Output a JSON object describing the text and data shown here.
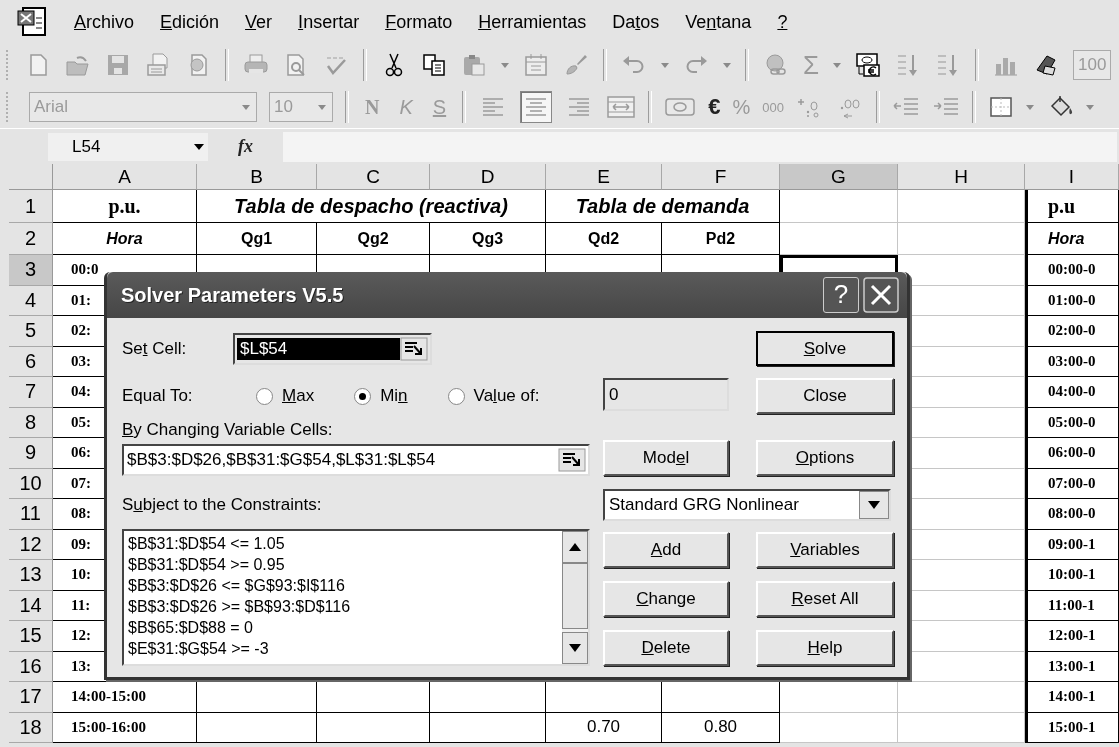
{
  "menu_bar": {
    "items": [
      {
        "key": "A",
        "post": "rchivo"
      },
      {
        "key": "E",
        "post": "dición"
      },
      {
        "key": "V",
        "post": "er"
      },
      {
        "key": "I",
        "post": "nsertar"
      },
      {
        "key": "F",
        "post": "ormato"
      },
      {
        "key": "H",
        "post": "erramientas"
      },
      {
        "pre": "Da",
        "key": "t",
        "post": "os"
      },
      {
        "pre": "Ve",
        "key": "n",
        "post": "tana"
      },
      {
        "key": "?"
      }
    ]
  },
  "standard_toolbar": {
    "autosum": "Σ",
    "zoom": "100"
  },
  "formatting_toolbar": {
    "font": "Arial",
    "size": "10",
    "style_buttons": [
      "N",
      "K",
      "S"
    ],
    "alignment": [
      {
        "selected": false
      },
      {
        "selected": true
      },
      {
        "selected": false
      }
    ],
    "number_buttons": [
      "€",
      "%",
      "000"
    ]
  },
  "formula_bar": {
    "name_box": "L54",
    "function_label": "fx"
  },
  "sheet": {
    "columns": [
      {
        "label": "A",
        "selected": false,
        "boxed": true
      },
      {
        "label": "B",
        "selected": false,
        "boxed": true
      },
      {
        "label": "C",
        "selected": false,
        "boxed": true
      },
      {
        "label": "D",
        "selected": false,
        "boxed": true
      },
      {
        "label": "E",
        "selected": false,
        "boxed": true
      },
      {
        "label": "F",
        "selected": false,
        "boxed": true
      },
      {
        "label": "G",
        "selected": true,
        "boxed": false
      },
      {
        "label": "H",
        "selected": false,
        "boxed": false
      },
      {
        "label": "I",
        "selected": false,
        "boxed": true
      }
    ],
    "rows": [
      {
        "label": "1",
        "selected": false,
        "cells": [
          {
            "text": "p.u.",
            "kind": "unit"
          },
          {
            "text": "Tabla de despacho (reactiva)",
            "kind": "title"
          },
          {
            "merged": true
          },
          {
            "merged": true
          },
          {
            "text": "Tabla de demanda",
            "kind": "title"
          },
          {
            "merged": true
          },
          null,
          null,
          {
            "text": "p.u",
            "kind": "unit"
          }
        ]
      },
      {
        "label": "2",
        "selected": false,
        "cells": [
          {
            "text": "Hora",
            "kind": "heading_italic"
          },
          {
            "text": "Qg1",
            "kind": "heading"
          },
          {
            "text": "Qg2",
            "kind": "heading"
          },
          {
            "text": "Qg3",
            "kind": "heading"
          },
          {
            "text": "Qd2",
            "kind": "heading"
          },
          {
            "text": "Pd2",
            "kind": "heading"
          },
          null,
          null,
          {
            "text": "Hora",
            "kind": "heading_italic"
          }
        ]
      },
      {
        "label": "3",
        "selected": true,
        "cells": [
          {
            "text": "00:0",
            "kind": "time"
          },
          null,
          null,
          null,
          null,
          null,
          {
            "outlined": true
          },
          null,
          {
            "text": "00:00-0",
            "kind": "time"
          }
        ]
      },
      {
        "label": "4",
        "selected": false,
        "cells": [
          {
            "text": "01:",
            "kind": "time"
          },
          null,
          null,
          null,
          null,
          null,
          null,
          null,
          {
            "text": "01:00-0",
            "kind": "time"
          }
        ]
      },
      {
        "label": "5",
        "selected": false,
        "cells": [
          {
            "text": "02:",
            "kind": "time"
          },
          null,
          null,
          null,
          null,
          null,
          null,
          null,
          {
            "text": "02:00-0",
            "kind": "time"
          }
        ]
      },
      {
        "label": "6",
        "selected": false,
        "cells": [
          {
            "text": "03:",
            "kind": "time"
          },
          null,
          null,
          null,
          null,
          null,
          null,
          null,
          {
            "text": "03:00-0",
            "kind": "time"
          }
        ]
      },
      {
        "label": "7",
        "selected": false,
        "cells": [
          {
            "text": "04:",
            "kind": "time"
          },
          null,
          null,
          null,
          null,
          null,
          null,
          null,
          {
            "text": "04:00-0",
            "kind": "time"
          }
        ]
      },
      {
        "label": "8",
        "selected": false,
        "cells": [
          {
            "text": "05:",
            "kind": "time"
          },
          null,
          null,
          null,
          null,
          null,
          null,
          null,
          {
            "text": "05:00-0",
            "kind": "time"
          }
        ]
      },
      {
        "label": "9",
        "selected": false,
        "cells": [
          {
            "text": "06:",
            "kind": "time"
          },
          null,
          null,
          null,
          null,
          null,
          null,
          null,
          {
            "text": "06:00-0",
            "kind": "time"
          }
        ]
      },
      {
        "label": "10",
        "selected": false,
        "cells": [
          {
            "text": "07:",
            "kind": "time"
          },
          null,
          null,
          null,
          null,
          null,
          null,
          null,
          {
            "text": "07:00-0",
            "kind": "time"
          }
        ]
      },
      {
        "label": "11",
        "selected": false,
        "cells": [
          {
            "text": "08:",
            "kind": "time"
          },
          null,
          null,
          null,
          null,
          null,
          null,
          null,
          {
            "text": "08:00-0",
            "kind": "time"
          }
        ]
      },
      {
        "label": "12",
        "selected": false,
        "cells": [
          {
            "text": "09:",
            "kind": "time"
          },
          null,
          null,
          null,
          null,
          null,
          null,
          null,
          {
            "text": "09:00-1",
            "kind": "time"
          }
        ]
      },
      {
        "label": "13",
        "selected": false,
        "cells": [
          {
            "text": "10:",
            "kind": "time"
          },
          null,
          null,
          null,
          null,
          null,
          null,
          null,
          {
            "text": "10:00-1",
            "kind": "time"
          }
        ]
      },
      {
        "label": "14",
        "selected": false,
        "cells": [
          {
            "text": "11:",
            "kind": "time"
          },
          null,
          null,
          null,
          null,
          null,
          null,
          null,
          {
            "text": "11:00-1",
            "kind": "time"
          }
        ]
      },
      {
        "label": "15",
        "selected": false,
        "cells": [
          {
            "text": "12:",
            "kind": "time"
          },
          null,
          null,
          null,
          null,
          null,
          null,
          null,
          {
            "text": "12:00-1",
            "kind": "time"
          }
        ]
      },
      {
        "label": "16",
        "selected": false,
        "cells": [
          {
            "text": "13:",
            "kind": "time"
          },
          null,
          null,
          null,
          null,
          null,
          null,
          null,
          {
            "text": "13:00-1",
            "kind": "time"
          }
        ]
      },
      {
        "label": "17",
        "selected": false,
        "cells": [
          {
            "text": "14:00-15:00",
            "kind": "time"
          },
          null,
          null,
          null,
          null,
          null,
          null,
          null,
          {
            "text": "14:00-1",
            "kind": "time"
          }
        ]
      },
      {
        "label": "18",
        "selected": false,
        "cells": [
          {
            "text": "15:00-16:00",
            "kind": "time"
          },
          null,
          null,
          null,
          {
            "text": "0.70",
            "kind": "number"
          },
          {
            "text": "0.80",
            "kind": "number"
          },
          null,
          null,
          {
            "text": "15:00-1",
            "kind": "time"
          }
        ]
      }
    ]
  },
  "dialog": {
    "title": "Solver Parameters V5.5",
    "help": "?",
    "set_cell": {
      "label": {
        "pre": "Se",
        "key": "t",
        "post": " Cell:"
      },
      "value": "$L$54",
      "selected": true
    },
    "equal_to": {
      "label": "Equal To:",
      "options": [
        {
          "label": {
            "key": "M",
            "post": "ax"
          },
          "selected": false
        },
        {
          "label": {
            "pre": "Mi",
            "key": "n"
          },
          "selected": true
        },
        {
          "label": {
            "pre": "Va",
            "key": "l",
            "post": "ue of:"
          },
          "selected": false
        }
      ],
      "value": "0"
    },
    "changing": {
      "label": {
        "key": "B",
        "post": "y Changing Variable Cells:"
      },
      "value": "$B$3:$D$26,$B$31:$G$54,$L$31:$L$54"
    },
    "constraints": {
      "label": {
        "pre": "S",
        "key": "u",
        "post": "bject to the Constraints:"
      },
      "items": [
        "$B$31:$D$54 <= 1.05",
        "$B$31:$D$54 >= 0.95",
        "$B$3:$D$26 <= $G$93:$I$116",
        "$B$3:$D$26 >= $B$93:$D$116",
        "$B$65:$D$88 = 0",
        "$E$31:$G$54 >= -3"
      ]
    },
    "engine": "Standard GRG Nonlinear",
    "buttons": [
      {
        "key": "S",
        "post": "olve"
      },
      {
        "pre": "Close"
      },
      {
        "pre": "Mod",
        "key": "e",
        "post": "l"
      },
      {
        "key": "O",
        "post": "ptions"
      },
      {
        "key": "A",
        "post": "dd"
      },
      {
        "key": "V",
        "post": "ariables"
      },
      {
        "key": "C",
        "post": "hange"
      },
      {
        "key": "R",
        "post": "eset All"
      },
      {
        "key": "D",
        "post": "elete"
      },
      {
        "key": "H",
        "post": "elp"
      }
    ]
  }
}
